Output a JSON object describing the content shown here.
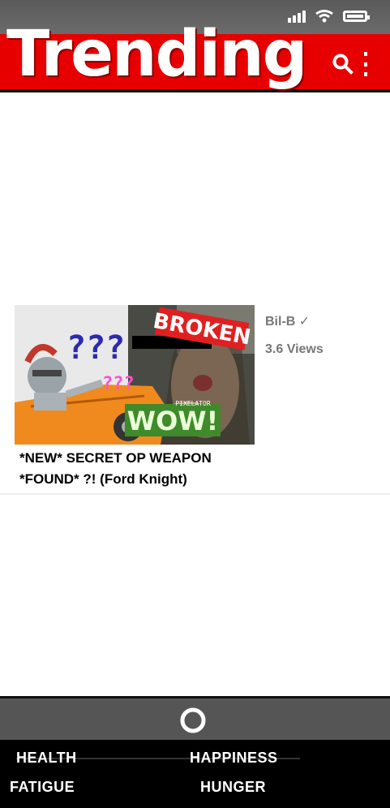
{
  "header": {
    "title": "Trending"
  },
  "video": {
    "thumbnail": {
      "left_text": "???",
      "small_text": "???",
      "broken_label": "BROKEN",
      "wow_label": "WOW!",
      "watermark": "PIXELATOR"
    },
    "channel": "Bil-B ✓",
    "views": "3.6 Views",
    "title": "*NEW* SECRET OP WEAPON *FOUND* ?! (Ford Knight)"
  },
  "stats": {
    "health": "HEALTH",
    "happiness": "HAPPINESS",
    "fatigue": "FATIGUE",
    "hunger": "HUNGER"
  },
  "colors": {
    "header_red": "#e60000",
    "status_gray": "#5a5a5a",
    "stats_black": "#000000"
  },
  "icons": [
    "signal-icon",
    "wifi-icon",
    "battery-icon",
    "search-icon",
    "more-vertical-icon",
    "home-circle-icon"
  ]
}
